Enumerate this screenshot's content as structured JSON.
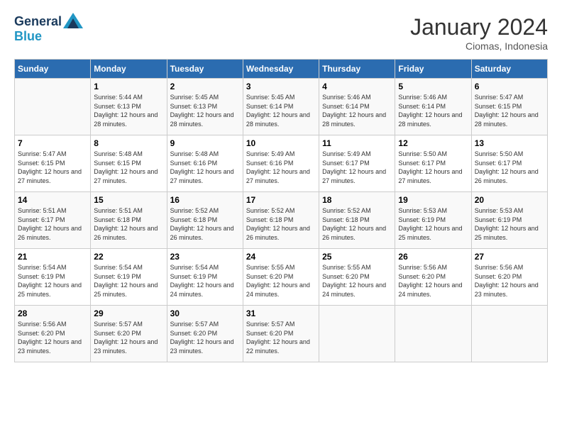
{
  "logo": {
    "line1": "General",
    "line2": "Blue"
  },
  "title": "January 2024",
  "location": "Ciomas, Indonesia",
  "weekdays": [
    "Sunday",
    "Monday",
    "Tuesday",
    "Wednesday",
    "Thursday",
    "Friday",
    "Saturday"
  ],
  "weeks": [
    [
      {
        "day": "",
        "sunrise": "",
        "sunset": "",
        "daylight": ""
      },
      {
        "day": "1",
        "sunrise": "Sunrise: 5:44 AM",
        "sunset": "Sunset: 6:13 PM",
        "daylight": "Daylight: 12 hours and 28 minutes."
      },
      {
        "day": "2",
        "sunrise": "Sunrise: 5:45 AM",
        "sunset": "Sunset: 6:13 PM",
        "daylight": "Daylight: 12 hours and 28 minutes."
      },
      {
        "day": "3",
        "sunrise": "Sunrise: 5:45 AM",
        "sunset": "Sunset: 6:14 PM",
        "daylight": "Daylight: 12 hours and 28 minutes."
      },
      {
        "day": "4",
        "sunrise": "Sunrise: 5:46 AM",
        "sunset": "Sunset: 6:14 PM",
        "daylight": "Daylight: 12 hours and 28 minutes."
      },
      {
        "day": "5",
        "sunrise": "Sunrise: 5:46 AM",
        "sunset": "Sunset: 6:14 PM",
        "daylight": "Daylight: 12 hours and 28 minutes."
      },
      {
        "day": "6",
        "sunrise": "Sunrise: 5:47 AM",
        "sunset": "Sunset: 6:15 PM",
        "daylight": "Daylight: 12 hours and 28 minutes."
      }
    ],
    [
      {
        "day": "7",
        "sunrise": "Sunrise: 5:47 AM",
        "sunset": "Sunset: 6:15 PM",
        "daylight": "Daylight: 12 hours and 27 minutes."
      },
      {
        "day": "8",
        "sunrise": "Sunrise: 5:48 AM",
        "sunset": "Sunset: 6:15 PM",
        "daylight": "Daylight: 12 hours and 27 minutes."
      },
      {
        "day": "9",
        "sunrise": "Sunrise: 5:48 AM",
        "sunset": "Sunset: 6:16 PM",
        "daylight": "Daylight: 12 hours and 27 minutes."
      },
      {
        "day": "10",
        "sunrise": "Sunrise: 5:49 AM",
        "sunset": "Sunset: 6:16 PM",
        "daylight": "Daylight: 12 hours and 27 minutes."
      },
      {
        "day": "11",
        "sunrise": "Sunrise: 5:49 AM",
        "sunset": "Sunset: 6:17 PM",
        "daylight": "Daylight: 12 hours and 27 minutes."
      },
      {
        "day": "12",
        "sunrise": "Sunrise: 5:50 AM",
        "sunset": "Sunset: 6:17 PM",
        "daylight": "Daylight: 12 hours and 27 minutes."
      },
      {
        "day": "13",
        "sunrise": "Sunrise: 5:50 AM",
        "sunset": "Sunset: 6:17 PM",
        "daylight": "Daylight: 12 hours and 26 minutes."
      }
    ],
    [
      {
        "day": "14",
        "sunrise": "Sunrise: 5:51 AM",
        "sunset": "Sunset: 6:17 PM",
        "daylight": "Daylight: 12 hours and 26 minutes."
      },
      {
        "day": "15",
        "sunrise": "Sunrise: 5:51 AM",
        "sunset": "Sunset: 6:18 PM",
        "daylight": "Daylight: 12 hours and 26 minutes."
      },
      {
        "day": "16",
        "sunrise": "Sunrise: 5:52 AM",
        "sunset": "Sunset: 6:18 PM",
        "daylight": "Daylight: 12 hours and 26 minutes."
      },
      {
        "day": "17",
        "sunrise": "Sunrise: 5:52 AM",
        "sunset": "Sunset: 6:18 PM",
        "daylight": "Daylight: 12 hours and 26 minutes."
      },
      {
        "day": "18",
        "sunrise": "Sunrise: 5:52 AM",
        "sunset": "Sunset: 6:18 PM",
        "daylight": "Daylight: 12 hours and 26 minutes."
      },
      {
        "day": "19",
        "sunrise": "Sunrise: 5:53 AM",
        "sunset": "Sunset: 6:19 PM",
        "daylight": "Daylight: 12 hours and 25 minutes."
      },
      {
        "day": "20",
        "sunrise": "Sunrise: 5:53 AM",
        "sunset": "Sunset: 6:19 PM",
        "daylight": "Daylight: 12 hours and 25 minutes."
      }
    ],
    [
      {
        "day": "21",
        "sunrise": "Sunrise: 5:54 AM",
        "sunset": "Sunset: 6:19 PM",
        "daylight": "Daylight: 12 hours and 25 minutes."
      },
      {
        "day": "22",
        "sunrise": "Sunrise: 5:54 AM",
        "sunset": "Sunset: 6:19 PM",
        "daylight": "Daylight: 12 hours and 25 minutes."
      },
      {
        "day": "23",
        "sunrise": "Sunrise: 5:54 AM",
        "sunset": "Sunset: 6:19 PM",
        "daylight": "Daylight: 12 hours and 24 minutes."
      },
      {
        "day": "24",
        "sunrise": "Sunrise: 5:55 AM",
        "sunset": "Sunset: 6:20 PM",
        "daylight": "Daylight: 12 hours and 24 minutes."
      },
      {
        "day": "25",
        "sunrise": "Sunrise: 5:55 AM",
        "sunset": "Sunset: 6:20 PM",
        "daylight": "Daylight: 12 hours and 24 minutes."
      },
      {
        "day": "26",
        "sunrise": "Sunrise: 5:56 AM",
        "sunset": "Sunset: 6:20 PM",
        "daylight": "Daylight: 12 hours and 24 minutes."
      },
      {
        "day": "27",
        "sunrise": "Sunrise: 5:56 AM",
        "sunset": "Sunset: 6:20 PM",
        "daylight": "Daylight: 12 hours and 23 minutes."
      }
    ],
    [
      {
        "day": "28",
        "sunrise": "Sunrise: 5:56 AM",
        "sunset": "Sunset: 6:20 PM",
        "daylight": "Daylight: 12 hours and 23 minutes."
      },
      {
        "day": "29",
        "sunrise": "Sunrise: 5:57 AM",
        "sunset": "Sunset: 6:20 PM",
        "daylight": "Daylight: 12 hours and 23 minutes."
      },
      {
        "day": "30",
        "sunrise": "Sunrise: 5:57 AM",
        "sunset": "Sunset: 6:20 PM",
        "daylight": "Daylight: 12 hours and 23 minutes."
      },
      {
        "day": "31",
        "sunrise": "Sunrise: 5:57 AM",
        "sunset": "Sunset: 6:20 PM",
        "daylight": "Daylight: 12 hours and 22 minutes."
      },
      {
        "day": "",
        "sunrise": "",
        "sunset": "",
        "daylight": ""
      },
      {
        "day": "",
        "sunrise": "",
        "sunset": "",
        "daylight": ""
      },
      {
        "day": "",
        "sunrise": "",
        "sunset": "",
        "daylight": ""
      }
    ]
  ]
}
